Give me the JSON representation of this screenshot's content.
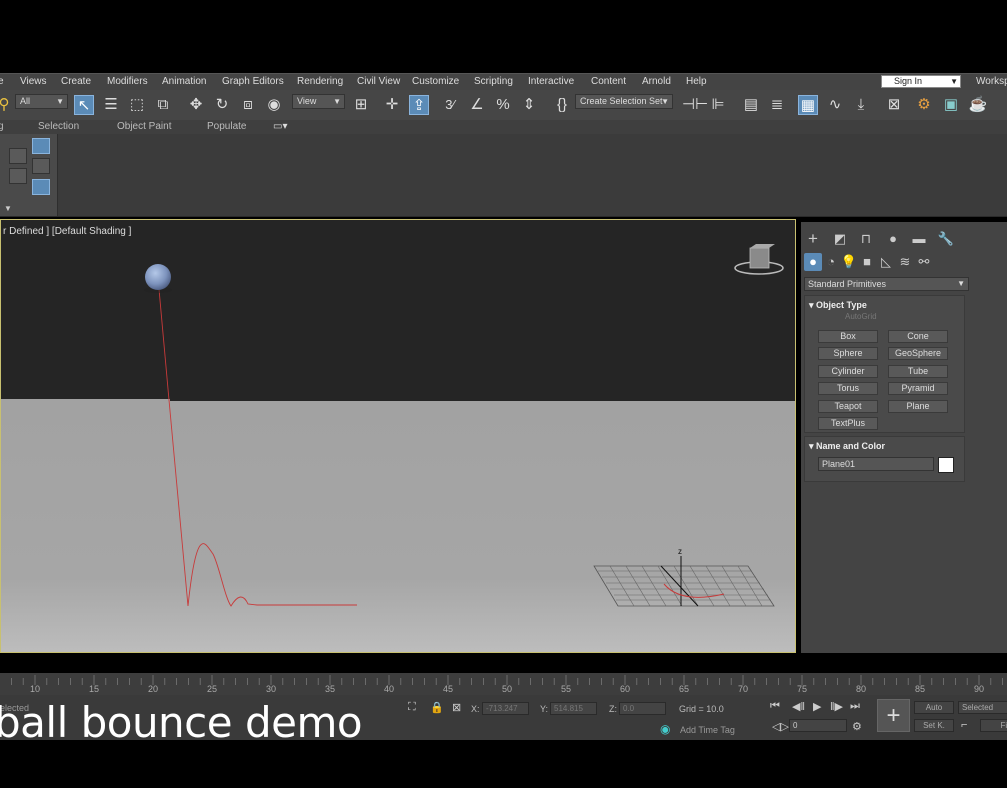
{
  "menu": {
    "items": [
      "Views",
      "Create",
      "Modifiers",
      "Animation",
      "Graph Editors",
      "Rendering",
      "Civil View",
      "Customize",
      "Scripting",
      "Interactive",
      "Content",
      "Arnold",
      "Help"
    ],
    "sign_in": "Sign In",
    "workspace": "Workspa"
  },
  "toolbar": {
    "filter_value": "All",
    "ref_coord_value": "View",
    "selection_set_placeholder": "Create Selection Set"
  },
  "ribbon_tabs": [
    "Selection",
    "Object Paint",
    "Populate"
  ],
  "viewport": {
    "label": "r Defined ] [Default Shading ]"
  },
  "command_panel": {
    "category": "Standard Primitives",
    "object_type_title": "Object Type",
    "autogrid": "AutoGrid",
    "buttons": [
      "Box",
      "Cone",
      "Sphere",
      "GeoSphere",
      "Cylinder",
      "Tube",
      "Torus",
      "Pyramid",
      "Teapot",
      "Plane",
      "TextPlus"
    ],
    "name_color_title": "Name and Color",
    "object_name": "Plane01",
    "object_color": "#ffffff"
  },
  "timeline": {
    "ticks": [
      "10",
      "15",
      "20",
      "25",
      "30",
      "35",
      "40",
      "45",
      "50",
      "55",
      "60",
      "65",
      "70",
      "75",
      "80",
      "85",
      "90"
    ]
  },
  "status": {
    "selected_text": "elected",
    "x_label": "X:",
    "x_value": "-713.247",
    "y_label": "Y:",
    "y_value": "514.815",
    "z_label": "Z:",
    "z_value": "0.0",
    "grid": "Grid = 10.0",
    "add_time_tag": "Add Time Tag",
    "frame_value": "0",
    "auto_label": "Auto",
    "selected_label": "Selected",
    "set_key_label": "Set K.",
    "filters_label": "Fil"
  },
  "overlay_title": "ball bounce demo",
  "axis_label": "z"
}
